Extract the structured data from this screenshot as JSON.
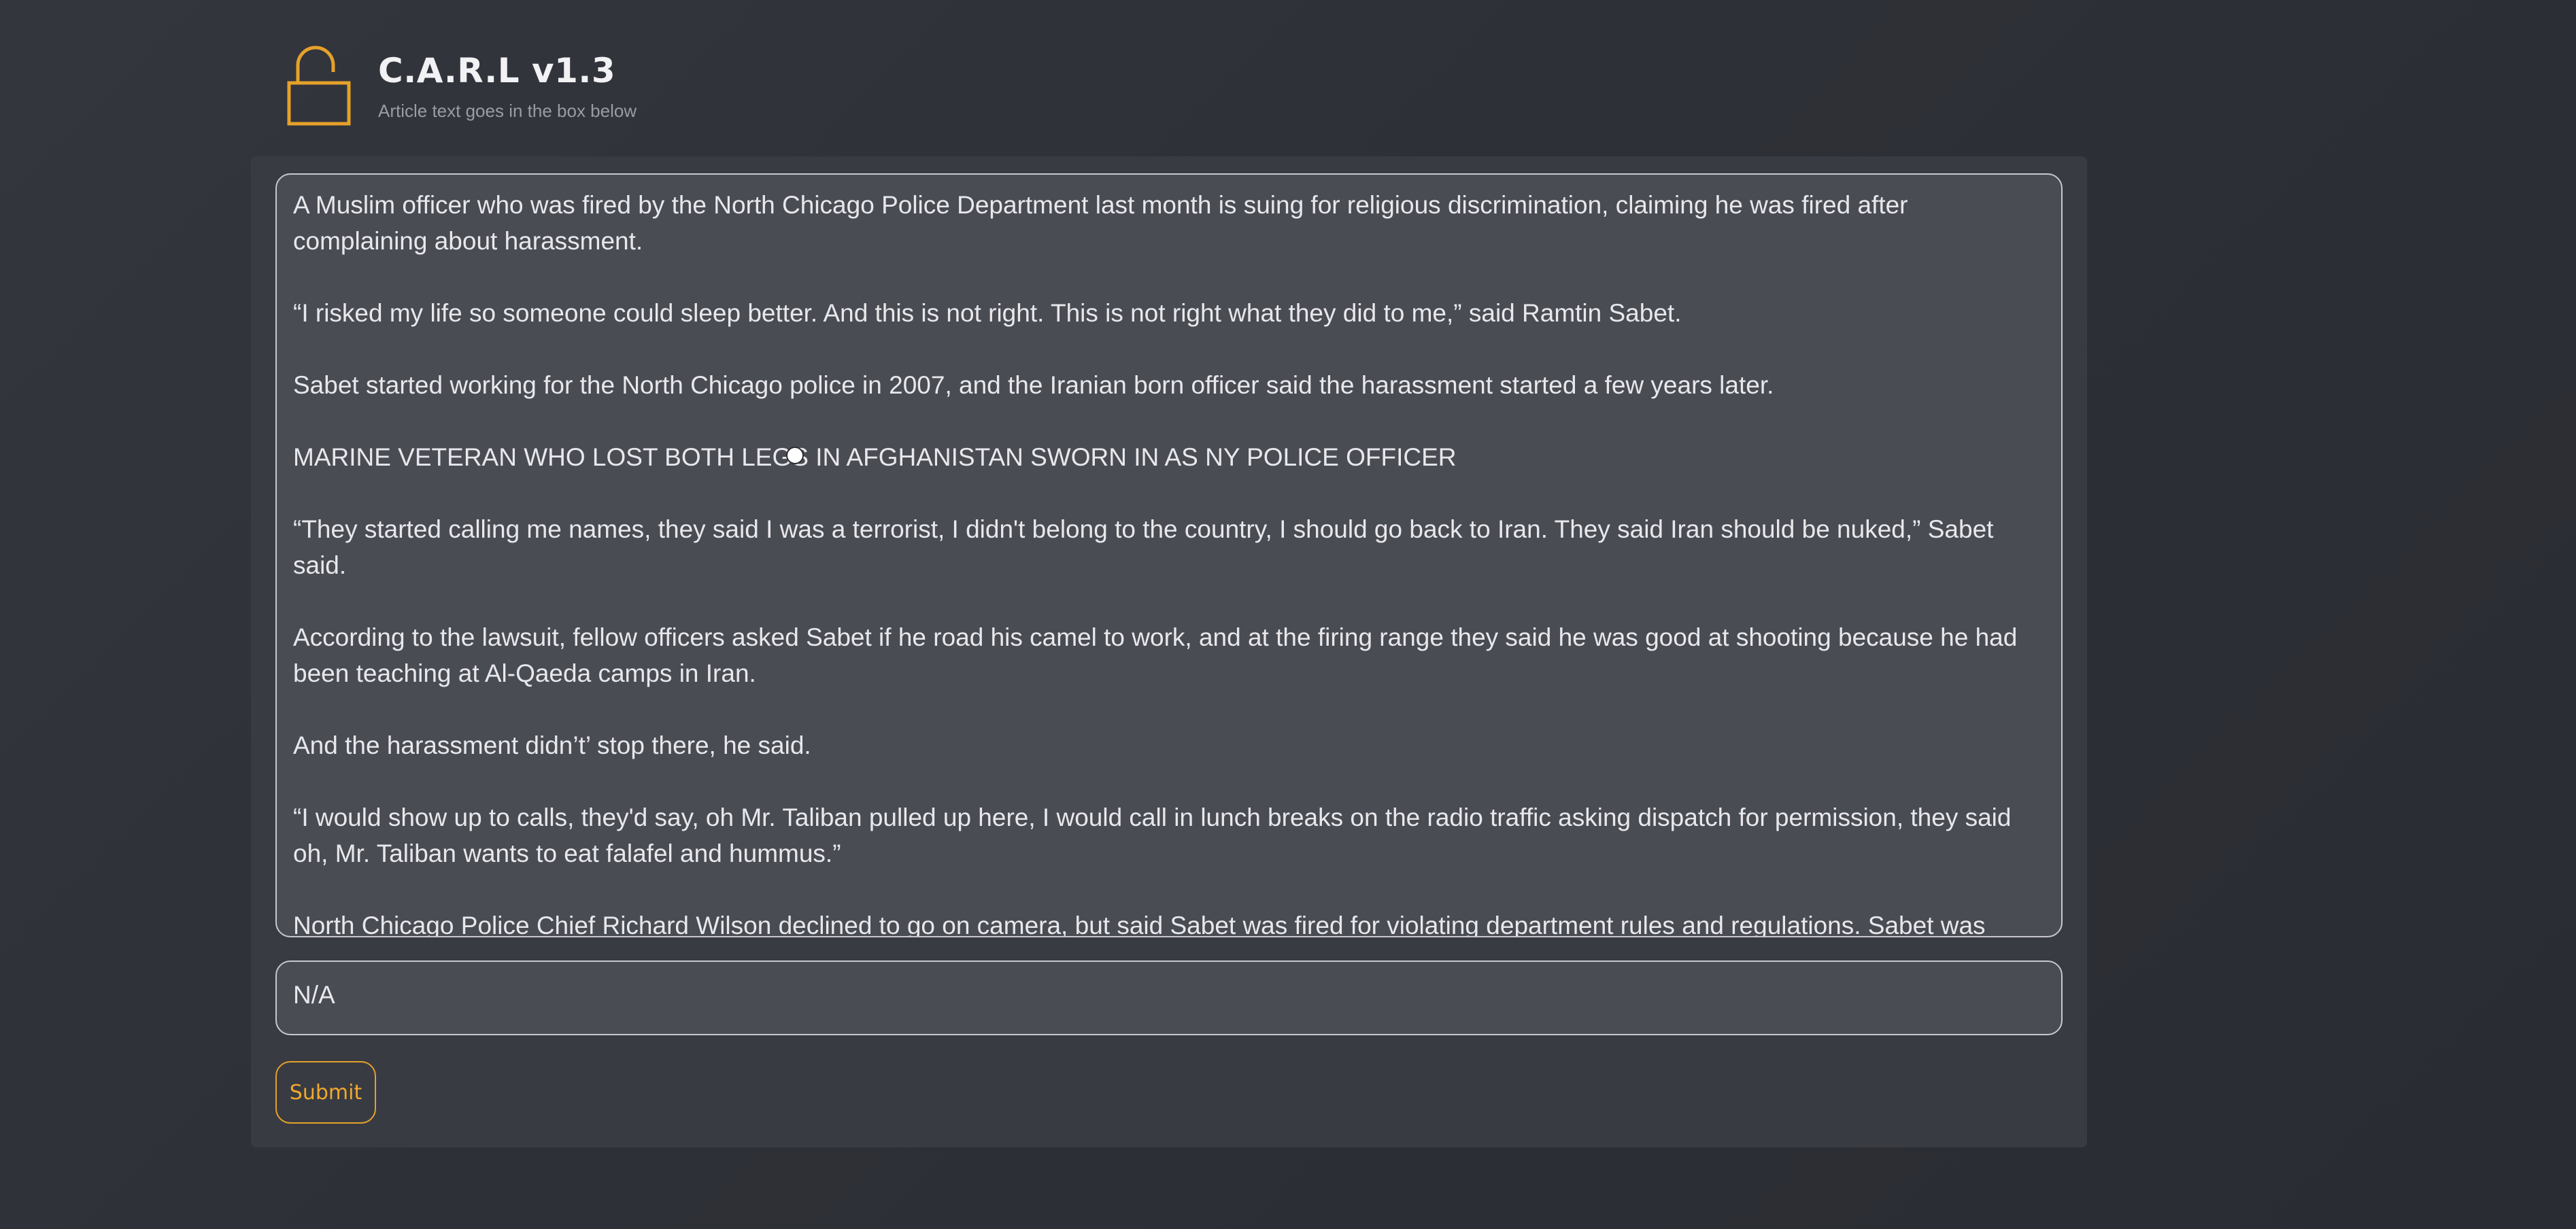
{
  "header": {
    "icon": "unlocked-padlock-icon",
    "title": "C.A.R.L v1.3",
    "subtitle": "Article text goes in the box below"
  },
  "article": {
    "paragraphs": [
      "A Muslim officer who was fired by the North Chicago Police Department last month is suing for religious discrimination, claiming he was fired after complaining about harassment.",
      "“I risked my life so someone could sleep better. And this is not right. This is not right what they did to me,” said Ramtin Sabet.",
      "Sabet started working for the North Chicago police in 2007, and the Iranian born officer said the harassment started a few years later.",
      "MARINE VETERAN WHO LOST BOTH LEGS IN AFGHANISTAN SWORN IN AS NY POLICE OFFICER",
      "“They started calling me names, they said I was a terrorist, I didn't belong to the country, I should go back to Iran. They said Iran should be nuked,” Sabet said.",
      "According to the lawsuit, fellow officers asked Sabet if he road his camel to work, and at the firing range they said he was good at shooting because he had been teaching at Al-Qaeda camps in Iran.",
      "And the harassment didn’t’ stop there, he said.",
      "“I would show up to calls, they'd say, oh Mr. Taliban pulled up here, I would call in lunch breaks on the radio traffic asking dispatch for permission, they said oh, Mr. Taliban wants to eat falafel and hummus.”",
      "North Chicago Police Chief Richard Wilson declined to go on camera, but said Sabet was fired for violating department rules and regulations.  Sabet was"
    ]
  },
  "result": {
    "value": "N/A"
  },
  "submit": {
    "label": "Submit"
  },
  "colors": {
    "accent": "#f0a92b",
    "background": "#2e3037",
    "panel": "#393b43",
    "field": "#4a4c54"
  }
}
